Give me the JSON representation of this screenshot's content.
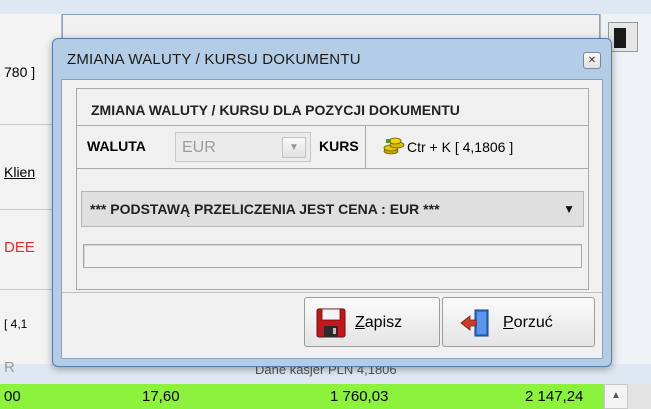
{
  "background": {
    "left_texts": [
      "780 ]",
      "Klien",
      "DEE",
      "[ 4,1",
      "R"
    ],
    "partial_text": "Dane kasjer PLN   4,1806",
    "table_row": [
      "00",
      "17,60",
      "1 760,03",
      "2 147,24"
    ],
    "row_color": "#8cf23c"
  },
  "dialog": {
    "title": "ZMIANA WALUTY / KURSU DOKUMENTU",
    "group_title": "ZMIANA WALUTY / KURSU DLA POZYCJI DOKUMENTU",
    "currency_label": "WALUTA",
    "currency_value": "EUR",
    "rate_label": "KURS",
    "rate_text": "Ctr + K [ 4,1806 ]",
    "basis_option": "*** PODSTAWĄ PRZELICZENIA JEST CENA : EUR ***",
    "progress_value": 0,
    "save_label_first": "Z",
    "save_label_rest": "apisz",
    "cancel_label_first": "P",
    "cancel_label_rest": "orzuć",
    "icons": {
      "close": "close-icon",
      "rate": "coins-icon",
      "save": "floppy-disk-icon",
      "cancel": "exit-door-icon"
    }
  }
}
